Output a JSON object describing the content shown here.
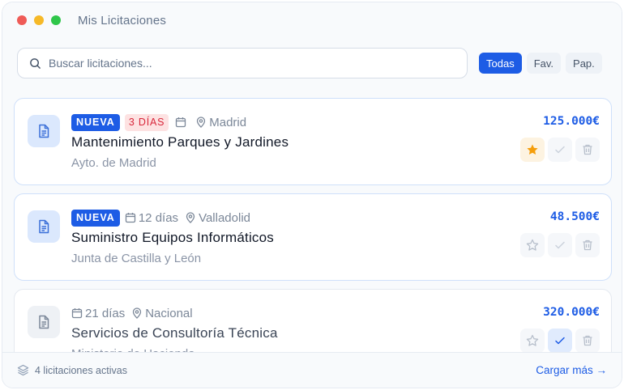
{
  "window": {
    "title": "Mis Licitaciones"
  },
  "search": {
    "placeholder": "Buscar licitaciones..."
  },
  "filters": [
    "Todas",
    "Fav.",
    "Pap."
  ],
  "tenders": [
    {
      "badge_new": "NUEVA",
      "badge_days": "3 DÍAS",
      "days": "",
      "location": "Madrid",
      "title": "Mantenimiento Parques y Jardines",
      "org": "Ayto. de Madrid",
      "price": "125.000€",
      "favorite": true,
      "checked": false
    },
    {
      "badge_new": "NUEVA",
      "badge_days": "",
      "days": "12 días",
      "location": "Valladolid",
      "title": "Suministro Equipos Informáticos",
      "org": "Junta de Castilla y León",
      "price": "48.500€",
      "favorite": false,
      "checked": false
    },
    {
      "badge_new": "",
      "badge_days": "",
      "days": "21 días",
      "location": "Nacional",
      "title": "Servicios de Consultoría Técnica",
      "org": "Ministerio de Hacienda",
      "price": "320.000€",
      "favorite": false,
      "checked": true
    }
  ],
  "footer": {
    "count": "4 licitaciones activas",
    "load_more": "Cargar más →"
  },
  "colors": {
    "accent": "#1d5ce5",
    "urgent": "#d8263a",
    "star": "#f59e0b"
  }
}
